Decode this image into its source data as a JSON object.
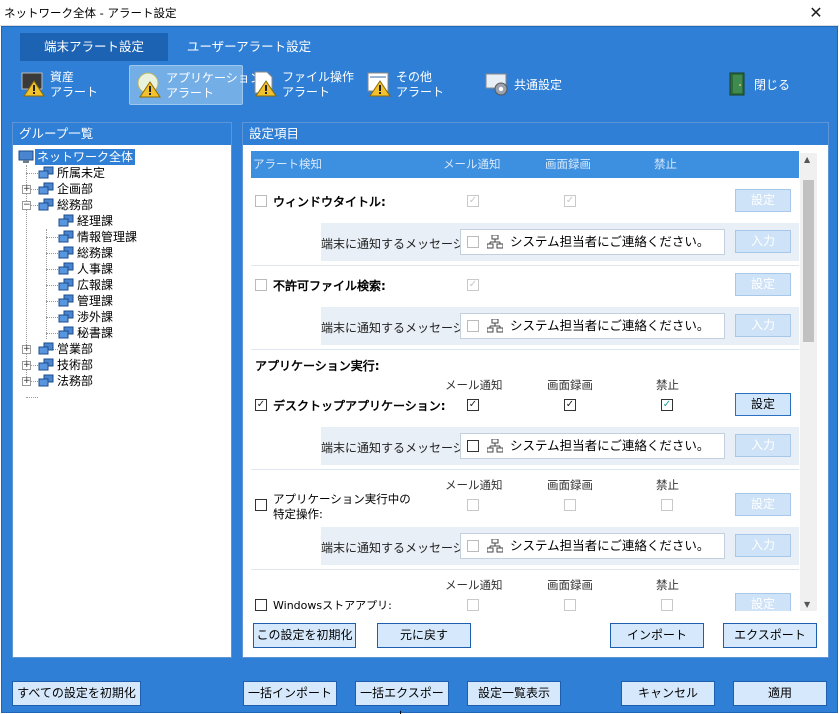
{
  "window": {
    "title": "ネットワーク全体 - アラート設定",
    "close_label": "✕"
  },
  "tabs": [
    {
      "label": "端末アラート設定"
    },
    {
      "label": "ユーザーアラート設定"
    }
  ],
  "toolbar": {
    "asset": {
      "line1": "資産",
      "line2": "アラート"
    },
    "application": {
      "line1": "アプリケーション",
      "line2": "アラート"
    },
    "file_ops": {
      "line1": "ファイル操作",
      "line2": "アラート"
    },
    "other": {
      "line1": "その他",
      "line2": "アラート"
    },
    "common": {
      "label": "共通設定"
    },
    "close": {
      "label": "閉じる"
    }
  },
  "group_panel": {
    "title": "グループ一覧",
    "tree": [
      {
        "label": "ネットワーク全体"
      },
      {
        "label": "所属未定"
      },
      {
        "label": "企画部"
      },
      {
        "label": "総務部"
      },
      {
        "label": "経理課"
      },
      {
        "label": "情報管理課"
      },
      {
        "label": "総務課"
      },
      {
        "label": "人事課"
      },
      {
        "label": "広報課"
      },
      {
        "label": "管理課"
      },
      {
        "label": "渉外課"
      },
      {
        "label": "秘書課"
      },
      {
        "label": "営業部"
      },
      {
        "label": "技術部"
      },
      {
        "label": "法務部"
      }
    ]
  },
  "settings_panel": {
    "title": "設定項目",
    "header": {
      "col0": "アラート検知",
      "col1": "メール通知",
      "col2": "画面録画",
      "col3": "禁止"
    },
    "msg_label": "端末に通知するメッセージ:",
    "msg_text": "システム担当者にご連絡ください。",
    "setting_btn": "設定",
    "input_btn": "入力",
    "window_title": "ウィンドウタイトル:",
    "forbidden_file": "不許可ファイル検索:",
    "app_exec": "アプリケーション実行:",
    "desktop_app": "デスクトップアプリケーション:",
    "specific_op_line1": "アプリケーション実行中の",
    "specific_op_line2": "特定操作:",
    "store_app": "Windowsストアアプリ:",
    "col_mail": "メール通知",
    "col_rec": "画面録画",
    "col_ban": "禁止",
    "check_mark": "✓"
  },
  "panel_buttons": {
    "reset": "この設定を初期化",
    "undo": "元に戻す",
    "import": "インポート",
    "export": "エクスポート"
  },
  "footer": {
    "reset_all": "すべての設定を初期化",
    "bulk_import": "一括インポート",
    "bulk_export": "一括エクスポート",
    "list_view": "設定一覧表示",
    "cancel": "キャンセル",
    "apply": "適用"
  },
  "colors": {
    "accent": "#2f7fd6",
    "header": "#3d8fe0",
    "msg_bg": "#e9eff6",
    "check_teal": "#1aa0a0"
  }
}
